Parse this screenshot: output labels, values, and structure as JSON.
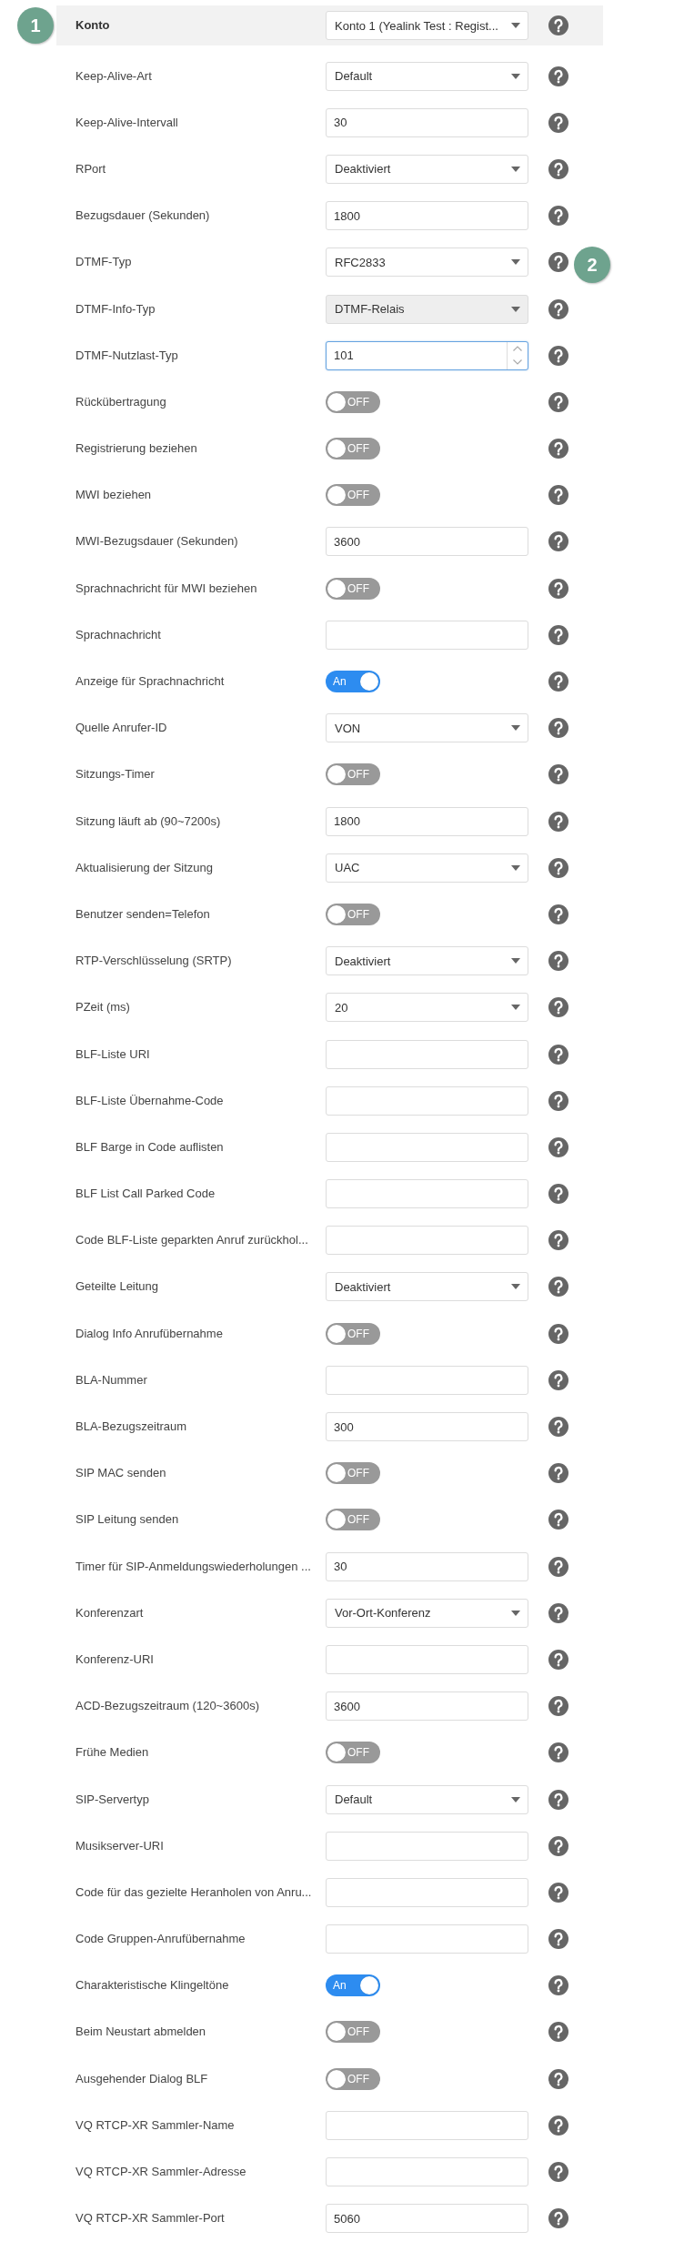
{
  "account": {
    "label": "Konto",
    "kind": "select",
    "value": "Konto 1 (Yealink Test : Regist...",
    "disabled": false,
    "focused": false,
    "marker": "1"
  },
  "rows": [
    {
      "label": "Keep-Alive-Art",
      "kind": "select",
      "value": "Default",
      "disabled": false,
      "focused": false
    },
    {
      "label": "Keep-Alive-Intervall",
      "kind": "text",
      "value": "30",
      "disabled": false,
      "focused": false
    },
    {
      "label": "RPort",
      "kind": "select",
      "value": "Deaktiviert",
      "disabled": false,
      "focused": false
    },
    {
      "label": "Bezugsdauer (Sekunden)",
      "kind": "text",
      "value": "1800",
      "disabled": false,
      "focused": false
    },
    {
      "label": "DTMF-Typ",
      "kind": "select",
      "value": "RFC2833",
      "disabled": false,
      "focused": false,
      "marker": "2"
    },
    {
      "label": "DTMF-Info-Typ",
      "kind": "select",
      "value": "DTMF-Relais",
      "disabled": true,
      "focused": false
    },
    {
      "label": "DTMF-Nutzlast-Typ",
      "kind": "number",
      "value": "101",
      "disabled": false,
      "focused": true
    },
    {
      "label": "Rückübertragung",
      "kind": "toggle",
      "on": false,
      "text": "OFF"
    },
    {
      "label": "Registrierung beziehen",
      "kind": "toggle",
      "on": false,
      "text": "OFF"
    },
    {
      "label": "MWI beziehen",
      "kind": "toggle",
      "on": false,
      "text": "OFF"
    },
    {
      "label": "MWI-Bezugsdauer (Sekunden)",
      "kind": "text",
      "value": "3600",
      "disabled": false,
      "focused": false
    },
    {
      "label": "Sprachnachricht für MWI beziehen",
      "kind": "toggle",
      "on": false,
      "text": "OFF"
    },
    {
      "label": "Sprachnachricht",
      "kind": "text",
      "disabled": false,
      "focused": false
    },
    {
      "label": "Anzeige für Sprachnachricht",
      "kind": "toggle",
      "on": true,
      "text": "An"
    },
    {
      "label": "Quelle Anrufer-ID",
      "kind": "select",
      "value": "VON",
      "disabled": false,
      "focused": false
    },
    {
      "label": "Sitzungs-Timer",
      "kind": "toggle",
      "on": false,
      "text": "OFF"
    },
    {
      "label": "Sitzung läuft ab (90~7200s)",
      "kind": "text",
      "value": "1800",
      "disabled": false,
      "focused": false
    },
    {
      "label": "Aktualisierung der Sitzung",
      "kind": "select",
      "value": "UAC",
      "disabled": false,
      "focused": false
    },
    {
      "label": "Benutzer senden=Telefon",
      "kind": "toggle",
      "on": false,
      "text": "OFF"
    },
    {
      "label": "RTP-Verschlüsselung (SRTP)",
      "kind": "select",
      "value": "Deaktiviert",
      "disabled": false,
      "focused": false
    },
    {
      "label": "PZeit (ms)",
      "kind": "select",
      "value": "20",
      "disabled": false,
      "focused": false
    },
    {
      "label": "BLF-Liste URI",
      "kind": "text",
      "disabled": false,
      "focused": false
    },
    {
      "label": "BLF-Liste Übernahme-Code",
      "kind": "text",
      "disabled": false,
      "focused": false
    },
    {
      "label": "BLF Barge in Code auflisten",
      "kind": "text",
      "disabled": false,
      "focused": false
    },
    {
      "label": "BLF List Call Parked Code",
      "kind": "text",
      "disabled": false,
      "focused": false
    },
    {
      "label": "Code BLF-Liste geparkten Anruf zurückhol...",
      "kind": "text",
      "disabled": false,
      "focused": false
    },
    {
      "label": "Geteilte Leitung",
      "kind": "select",
      "value": "Deaktiviert",
      "disabled": false,
      "focused": false
    },
    {
      "label": "Dialog Info Anrufübernahme",
      "kind": "toggle",
      "on": false,
      "text": "OFF"
    },
    {
      "label": "BLA-Nummer",
      "kind": "text",
      "disabled": false,
      "focused": false
    },
    {
      "label": "BLA-Bezugszeitraum",
      "kind": "text",
      "value": "300",
      "disabled": false,
      "focused": false
    },
    {
      "label": "SIP MAC senden",
      "kind": "toggle",
      "on": false,
      "text": "OFF"
    },
    {
      "label": "SIP Leitung senden",
      "kind": "toggle",
      "on": false,
      "text": "OFF"
    },
    {
      "label": "Timer für SIP-Anmeldungswiederholungen ...",
      "kind": "text",
      "value": "30",
      "disabled": false,
      "focused": false
    },
    {
      "label": "Konferenzart",
      "kind": "select",
      "value": "Vor-Ort-Konferenz",
      "disabled": false,
      "focused": false
    },
    {
      "label": "Konferenz-URI",
      "kind": "text",
      "disabled": false,
      "focused": false
    },
    {
      "label": "ACD-Bezugszeitraum (120~3600s)",
      "kind": "text",
      "value": "3600",
      "disabled": false,
      "focused": false
    },
    {
      "label": "Frühe Medien",
      "kind": "toggle",
      "on": false,
      "text": "OFF"
    },
    {
      "label": "SIP-Servertyp",
      "kind": "select",
      "value": "Default",
      "disabled": false,
      "focused": false
    },
    {
      "label": "Musikserver-URI",
      "kind": "text",
      "disabled": false,
      "focused": false
    },
    {
      "label": "Code für das gezielte Heranholen von Anru...",
      "kind": "text",
      "disabled": false,
      "focused": false
    },
    {
      "label": "Code Gruppen-Anrufübernahme",
      "kind": "text",
      "disabled": false,
      "focused": false
    },
    {
      "label": "Charakteristische Klingeltöne",
      "kind": "toggle",
      "on": true,
      "text": "An"
    },
    {
      "label": "Beim Neustart abmelden",
      "kind": "toggle",
      "on": false,
      "text": "OFF"
    },
    {
      "label": "Ausgehender Dialog BLF",
      "kind": "toggle",
      "on": false,
      "text": "OFF"
    },
    {
      "label": "VQ RTCP-XR Sammler-Name",
      "kind": "text",
      "disabled": false,
      "focused": false
    },
    {
      "label": "VQ RTCP-XR Sammler-Adresse",
      "kind": "text",
      "disabled": false,
      "focused": false
    },
    {
      "label": "VQ RTCP-XR Sammler-Port",
      "kind": "text",
      "value": "5060",
      "disabled": false,
      "focused": false
    }
  ]
}
